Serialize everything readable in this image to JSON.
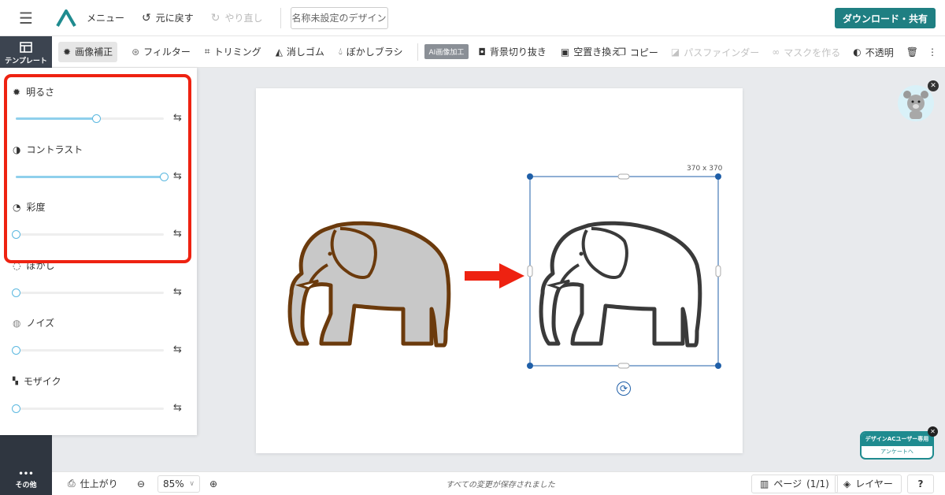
{
  "topbar": {
    "menu_label": "メニュー",
    "undo_label": "元に戻す",
    "redo_label": "やり直し",
    "doc_name": "名称未設定のデザイン",
    "download_label": "ダウンロード・共有"
  },
  "rail": {
    "templates_label": "テンプレート",
    "more_label": "その他"
  },
  "toolbar": {
    "items": [
      {
        "label": "画像補正",
        "icon": "sun-adjust-icon"
      },
      {
        "label": "フィルター",
        "icon": "filter-icon"
      },
      {
        "label": "トリミング",
        "icon": "crop-icon"
      },
      {
        "label": "消しゴム",
        "icon": "eraser-icon"
      },
      {
        "label": "ぼかしブラシ",
        "icon": "blur-drop-icon"
      }
    ],
    "ai_badge": "AI画像加工",
    "ai_items": [
      {
        "label": "背景切り抜き",
        "icon": "person-cutout-icon"
      },
      {
        "label": "空置き換え",
        "icon": "sky-replace-icon"
      }
    ],
    "right_items": [
      {
        "label": "コピー",
        "icon": "copy-icon"
      },
      {
        "label": "パスファインダー",
        "icon": "pathfinder-icon"
      },
      {
        "label": "マスクを作る",
        "icon": "mask-icon"
      },
      {
        "label": "不透明",
        "icon": "opacity-icon"
      }
    ]
  },
  "panel": {
    "adjustments": [
      {
        "label": "明るさ",
        "icon": "brightness-icon",
        "value": 0.54
      },
      {
        "label": "コントラスト",
        "icon": "contrast-icon",
        "value": 1.0
      },
      {
        "label": "彩度",
        "icon": "saturation-icon",
        "value": 0.0
      },
      {
        "label": "ぼかし",
        "icon": "blur-icon",
        "value": 0.0
      },
      {
        "label": "ノイズ",
        "icon": "noise-icon",
        "value": 0.0
      },
      {
        "label": "モザイク",
        "icon": "mosaic-icon",
        "value": 0.0
      }
    ]
  },
  "canvas": {
    "selection_size": "370 x 370"
  },
  "promo": {
    "title": "デザインACユーザー専用",
    "link": "アンケートへ"
  },
  "bottombar": {
    "finish_label": "仕上がり",
    "zoom_value": "85%",
    "status": "すべての変更が保存されました",
    "page_label": "ページ",
    "page_count": "(1/1)",
    "layers_label": "レイヤー",
    "help": "?"
  },
  "colors": {
    "accent": "#1f7f82",
    "rail": "#2f3640",
    "highlight": "#ee2211",
    "arrow": "#ee2211",
    "elephant_fill": "#c8c8c8",
    "elephant_outline": "#6b3a0c",
    "selection": "#1f5fa8"
  }
}
